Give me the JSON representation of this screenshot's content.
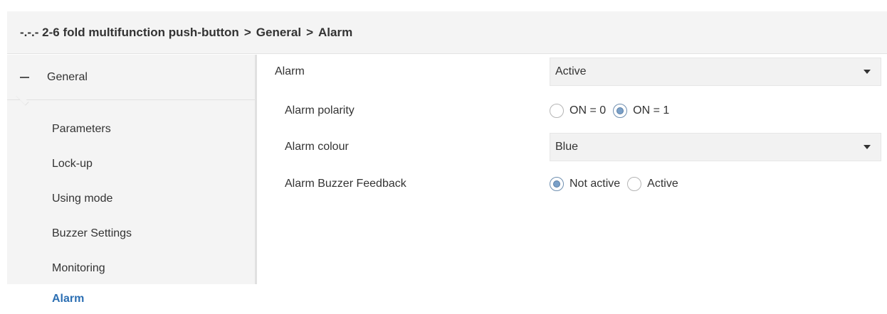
{
  "breadcrumb": {
    "device": "-.-.- 2-6 fold multifunction push-button",
    "separator": ">",
    "section": "General",
    "page": "Alarm"
  },
  "sidebar": {
    "group_label": "General",
    "group_state": "expanded",
    "items": [
      {
        "label": "Parameters"
      },
      {
        "label": "Lock-up"
      },
      {
        "label": "Using mode"
      },
      {
        "label": "Buzzer Settings"
      },
      {
        "label": "Monitoring"
      }
    ],
    "active_item": "Alarm",
    "active_color": "#2c6fb3"
  },
  "params": {
    "alarm": {
      "label": "Alarm",
      "value": "Active"
    },
    "polarity": {
      "label": "Alarm polarity",
      "options": [
        "ON = 0",
        "ON = 1"
      ],
      "selected": "ON = 1"
    },
    "colour": {
      "label": "Alarm colour",
      "value": "Blue"
    },
    "buzzer": {
      "label": "Alarm Buzzer Feedback",
      "options": [
        "Not active",
        "Active"
      ],
      "selected": "Not active"
    }
  }
}
